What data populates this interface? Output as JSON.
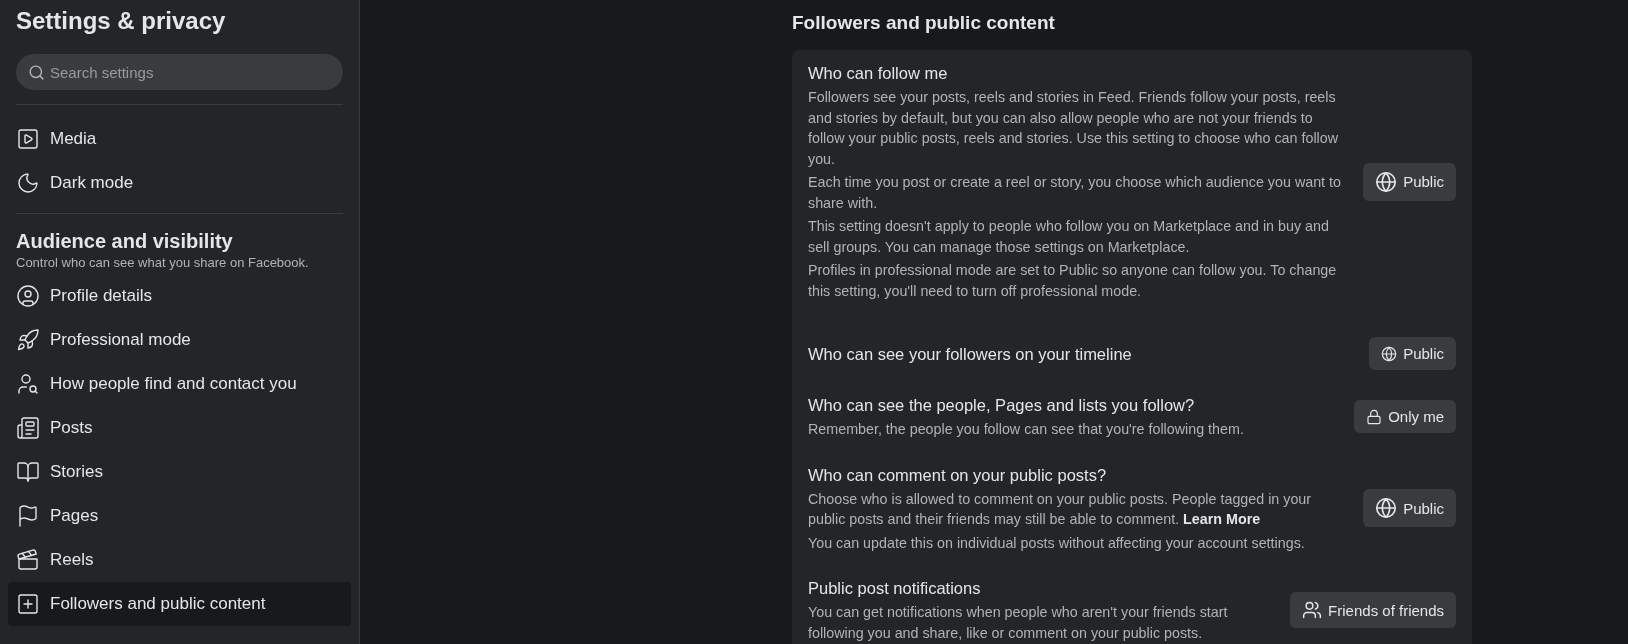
{
  "sidebar": {
    "title": "Settings & privacy",
    "search": {
      "placeholder": "Search settings"
    },
    "groups": [
      {
        "items": [
          {
            "label": "Media",
            "selected": false
          },
          {
            "label": "Dark mode",
            "selected": false
          }
        ]
      },
      {
        "heading": "Audience and visibility",
        "subheading": "Control who can see what you share on Facebook.",
        "items": [
          {
            "label": "Profile details",
            "selected": false
          },
          {
            "label": "Professional mode",
            "selected": false
          },
          {
            "label": "How people find and contact you",
            "selected": false
          },
          {
            "label": "Posts",
            "selected": false
          },
          {
            "label": "Stories",
            "selected": false
          },
          {
            "label": "Pages",
            "selected": false
          },
          {
            "label": "Reels",
            "selected": false
          },
          {
            "label": "Followers and public content",
            "selected": true
          }
        ]
      }
    ]
  },
  "main": {
    "title": "Followers and public content",
    "settings": [
      {
        "title": "Who can follow me",
        "paragraphs": [
          {
            "text": "Followers see your posts, reels and stories in Feed. Friends follow your posts, reels and stories by default, but you can also allow people who are not your friends to follow your public posts, reels and stories. Use this setting to choose who can follow you."
          },
          {
            "text": "Each time you post or create a reel or story, you choose which audience you want to share with."
          },
          {
            "text": "This setting doesn't apply to people who follow you on Marketplace and in buy and sell groups. You can manage those settings on Marketplace."
          },
          {
            "text": "Profiles in professional mode are set to Public so anyone can follow you. To change this setting, you'll need to turn off professional mode."
          }
        ],
        "button": {
          "label": "Public"
        }
      },
      {
        "title": "Who can see your followers on your timeline",
        "button": {
          "label": "Public"
        }
      },
      {
        "title": "Who can see the people, Pages and lists you follow?",
        "paragraphs": [
          {
            "text": "Remember, the people you follow can see that you're following them."
          }
        ],
        "button": {
          "label": "Only me"
        }
      },
      {
        "title": "Who can comment on your public posts?",
        "paragraphs": [
          {
            "text": "Choose who is allowed to comment on your public posts. People tagged in your public posts and their friends may still be able to comment.",
            "link": "Learn More"
          },
          {
            "text": "You can update this on individual posts without affecting your account settings."
          }
        ],
        "button": {
          "label": "Public"
        }
      },
      {
        "title": "Public post notifications",
        "paragraphs": [
          {
            "text": "You can get notifications when people who aren't your friends start following you and share, like or comment on your public posts."
          }
        ],
        "button": {
          "label": "Friends of friends"
        }
      }
    ]
  }
}
